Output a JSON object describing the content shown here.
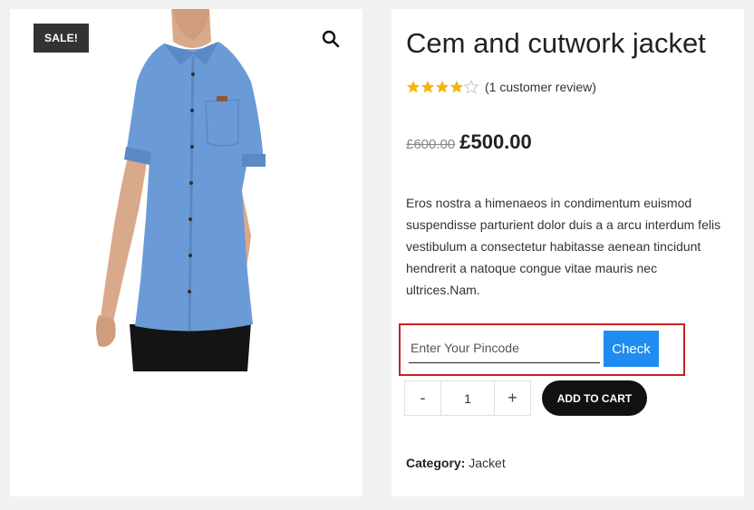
{
  "gallery": {
    "sale_badge": "SALE!",
    "zoom_icon": "search-icon"
  },
  "product": {
    "title": "Cem and cutwork jacket",
    "rating": 4,
    "rating_max": 5,
    "review_link": "(1 customer review)",
    "old_price": "£600.00",
    "price": "£500.00",
    "description": "Eros nostra a himenaeos in condimentum euismod suspendisse parturient dolor duis a a arcu interdum felis vestibulum a consectetur habitasse aenean tincidunt hendrerit a natoque congue vitae mauris nec ultrices.Nam.",
    "category_label": "Category:",
    "category": "Jacket"
  },
  "pincode": {
    "placeholder": "Enter Your Pincode",
    "check_label": "Check",
    "highlight_color": "#c91f25",
    "button_color": "#1e8cf0"
  },
  "cart": {
    "minus": "-",
    "quantity": "1",
    "plus": "+",
    "add_label": "ADD TO CART"
  },
  "colors": {
    "star": "#f5b50f",
    "star_empty": "#c9c9c9"
  }
}
